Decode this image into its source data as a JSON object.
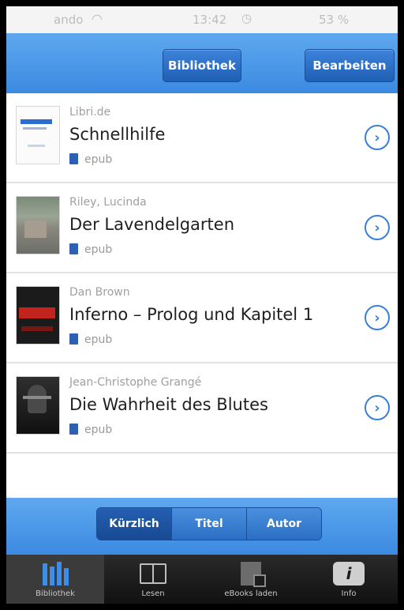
{
  "status_bar": {
    "carrier": "ando",
    "time": "13:42",
    "battery": "53 %",
    "wifi_icon": "wifi-icon",
    "alarm_icon": "alarm-icon"
  },
  "header": {
    "library_button": "Bibliothek",
    "edit_button": "Bearbeiten"
  },
  "books": [
    {
      "author": "Libri.de",
      "title": "Schnellhilfe",
      "format": "epub"
    },
    {
      "author": "Riley, Lucinda",
      "title": "Der Lavendelgarten",
      "format": "epub"
    },
    {
      "author": "Dan Brown",
      "title": "Inferno – Prolog und Kapitel 1",
      "format": "epub"
    },
    {
      "author": "Jean-Christophe Grangé",
      "title": "Die Wahrheit des Blutes",
      "format": "epub"
    }
  ],
  "sort": {
    "options": [
      "Kürzlich",
      "Titel",
      "Autor"
    ],
    "selected": "Kürzlich"
  },
  "tabs": [
    {
      "label": "Bibliothek",
      "icon": "library-icon",
      "active": true
    },
    {
      "label": "Lesen",
      "icon": "book-icon",
      "active": false
    },
    {
      "label": "eBooks laden",
      "icon": "download-icon",
      "active": false
    },
    {
      "label": "Info",
      "icon": "info-icon",
      "active": false
    }
  ],
  "colors": {
    "accent": "#3b8ae2",
    "button": "#1f5fb4",
    "tabbar": "#111111"
  }
}
